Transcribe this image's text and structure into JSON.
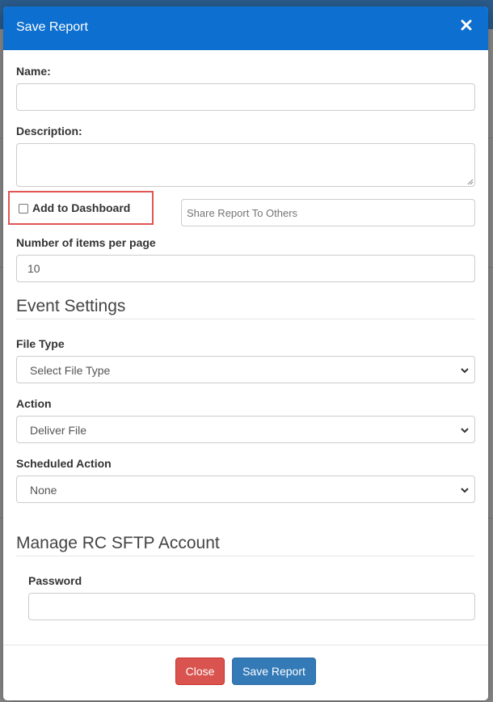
{
  "modal": {
    "title": "Save Report"
  },
  "form": {
    "name_label": "Name:",
    "name_value": "",
    "description_label": "Description:",
    "description_value": "",
    "add_to_dashboard_label": "Add to Dashboard",
    "add_to_dashboard_checked": false,
    "share_placeholder": "Share Report To Others",
    "items_per_page_label": "Number of items per page",
    "items_per_page_value": "10"
  },
  "event_settings": {
    "title": "Event Settings",
    "file_type_label": "File Type",
    "file_type_value": "Select File Type",
    "action_label": "Action",
    "action_value": "Deliver File",
    "scheduled_action_label": "Scheduled Action",
    "scheduled_action_value": "None"
  },
  "sftp": {
    "title": "Manage RC SFTP Account",
    "password_label": "Password",
    "password_value": ""
  },
  "footer": {
    "close_label": "Close",
    "save_label": "Save Report"
  },
  "colors": {
    "header": "#0d6fcf",
    "close_button": "#d9534f",
    "save_button": "#337ab7",
    "highlight_border": "#e05555"
  },
  "icons": {
    "close": "close-icon",
    "chevron": "chevron-down-icon"
  }
}
